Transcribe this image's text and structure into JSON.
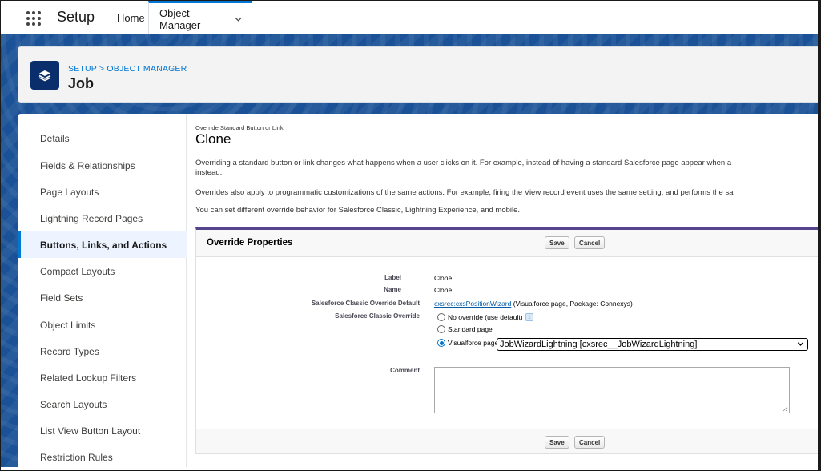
{
  "app": {
    "name": "Setup"
  },
  "tabs": [
    {
      "label": "Home"
    },
    {
      "label": "Object Manager",
      "active": true
    }
  ],
  "header": {
    "breadcrumb": "SETUP > OBJECT MANAGER",
    "title": "Job",
    "icon": "layers-icon"
  },
  "sidebar": {
    "items": [
      {
        "label": "Details"
      },
      {
        "label": "Fields & Relationships"
      },
      {
        "label": "Page Layouts"
      },
      {
        "label": "Lightning Record Pages"
      },
      {
        "label": "Buttons, Links, and Actions",
        "active": true
      },
      {
        "label": "Compact Layouts"
      },
      {
        "label": "Field Sets"
      },
      {
        "label": "Object Limits"
      },
      {
        "label": "Record Types"
      },
      {
        "label": "Related Lookup Filters"
      },
      {
        "label": "Search Layouts"
      },
      {
        "label": "List View Button Layout"
      },
      {
        "label": "Restriction Rules"
      }
    ]
  },
  "content": {
    "subtitle": "Override Standard Button or Link",
    "title": "Clone",
    "para1_line1": "Overriding a standard button or link changes what happens when a user clicks on it. For example, instead of having a standard Salesforce page appear when a",
    "para1_line2": "instead.",
    "para2": "Overrides also apply to programmatic customizations of the same actions. For example, firing the View record event uses the same setting, and performs the sa",
    "para3": "You can set different override behavior for Salesforce Classic, Lightning Experience, and mobile."
  },
  "panel": {
    "title": "Override Properties",
    "save_label": "Save",
    "cancel_label": "Cancel",
    "fields": {
      "label_label": "Label",
      "label_value": "Clone",
      "name_label": "Name",
      "name_value": "Clone",
      "classic_default_label": "Salesforce Classic Override Default",
      "classic_default_link": "cxsrec:cxsPositionWizard",
      "classic_default_suffix": "(Visualforce page, Package: Connexys)",
      "classic_override_label": "Salesforce Classic Override",
      "options": [
        {
          "label": "No override (use default)",
          "checked": false
        },
        {
          "label": "Standard page",
          "checked": false
        },
        {
          "label": "Visualforce page",
          "checked": true
        }
      ],
      "visualforce_selected": "JobWizardLightning [cxsrec__JobWizardLightning]",
      "comment_label": "Comment",
      "comment_value": ""
    }
  },
  "colors": {
    "brand_blue": "#0176d3",
    "band_blue": "#1b5297",
    "panel_accent": "#56458c"
  }
}
